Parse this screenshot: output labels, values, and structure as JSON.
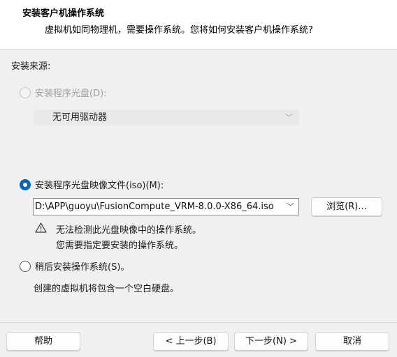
{
  "header": {
    "title": "安装客户机操作系统",
    "subtitle": "虚拟机如同物理机，需要操作系统。您将如何安装客户机操作系统?"
  },
  "install_source": {
    "label": "安装来源:",
    "options": {
      "disc": {
        "label": "安装程序光盘(D):",
        "selected": false,
        "enabled": false
      },
      "iso": {
        "label": "安装程序光盘映像文件(iso)(M):",
        "selected": true,
        "enabled": true
      },
      "later": {
        "label": "稍后安装操作系统(S)。",
        "selected": false,
        "enabled": true
      }
    },
    "drive_select": {
      "value": "无可用驱动器"
    },
    "iso_path": {
      "value": "D:\\APP\\guoyu\\FusionCompute_VRM-8.0.0-X86_64.iso"
    },
    "browse_label": "浏览(R)...",
    "warning": {
      "icon": "warning-icon",
      "line1": "无法检测此光盘映像中的操作系统。",
      "line2": "您需要指定要安装的操作系统。"
    },
    "empty_disk_note": "创建的虚拟机将包含一个空白硬盘。"
  },
  "footer": {
    "help_label": "帮助",
    "back_label": "< 上一步(B)",
    "next_label": "下一步(N) >",
    "cancel_label": "取消"
  }
}
